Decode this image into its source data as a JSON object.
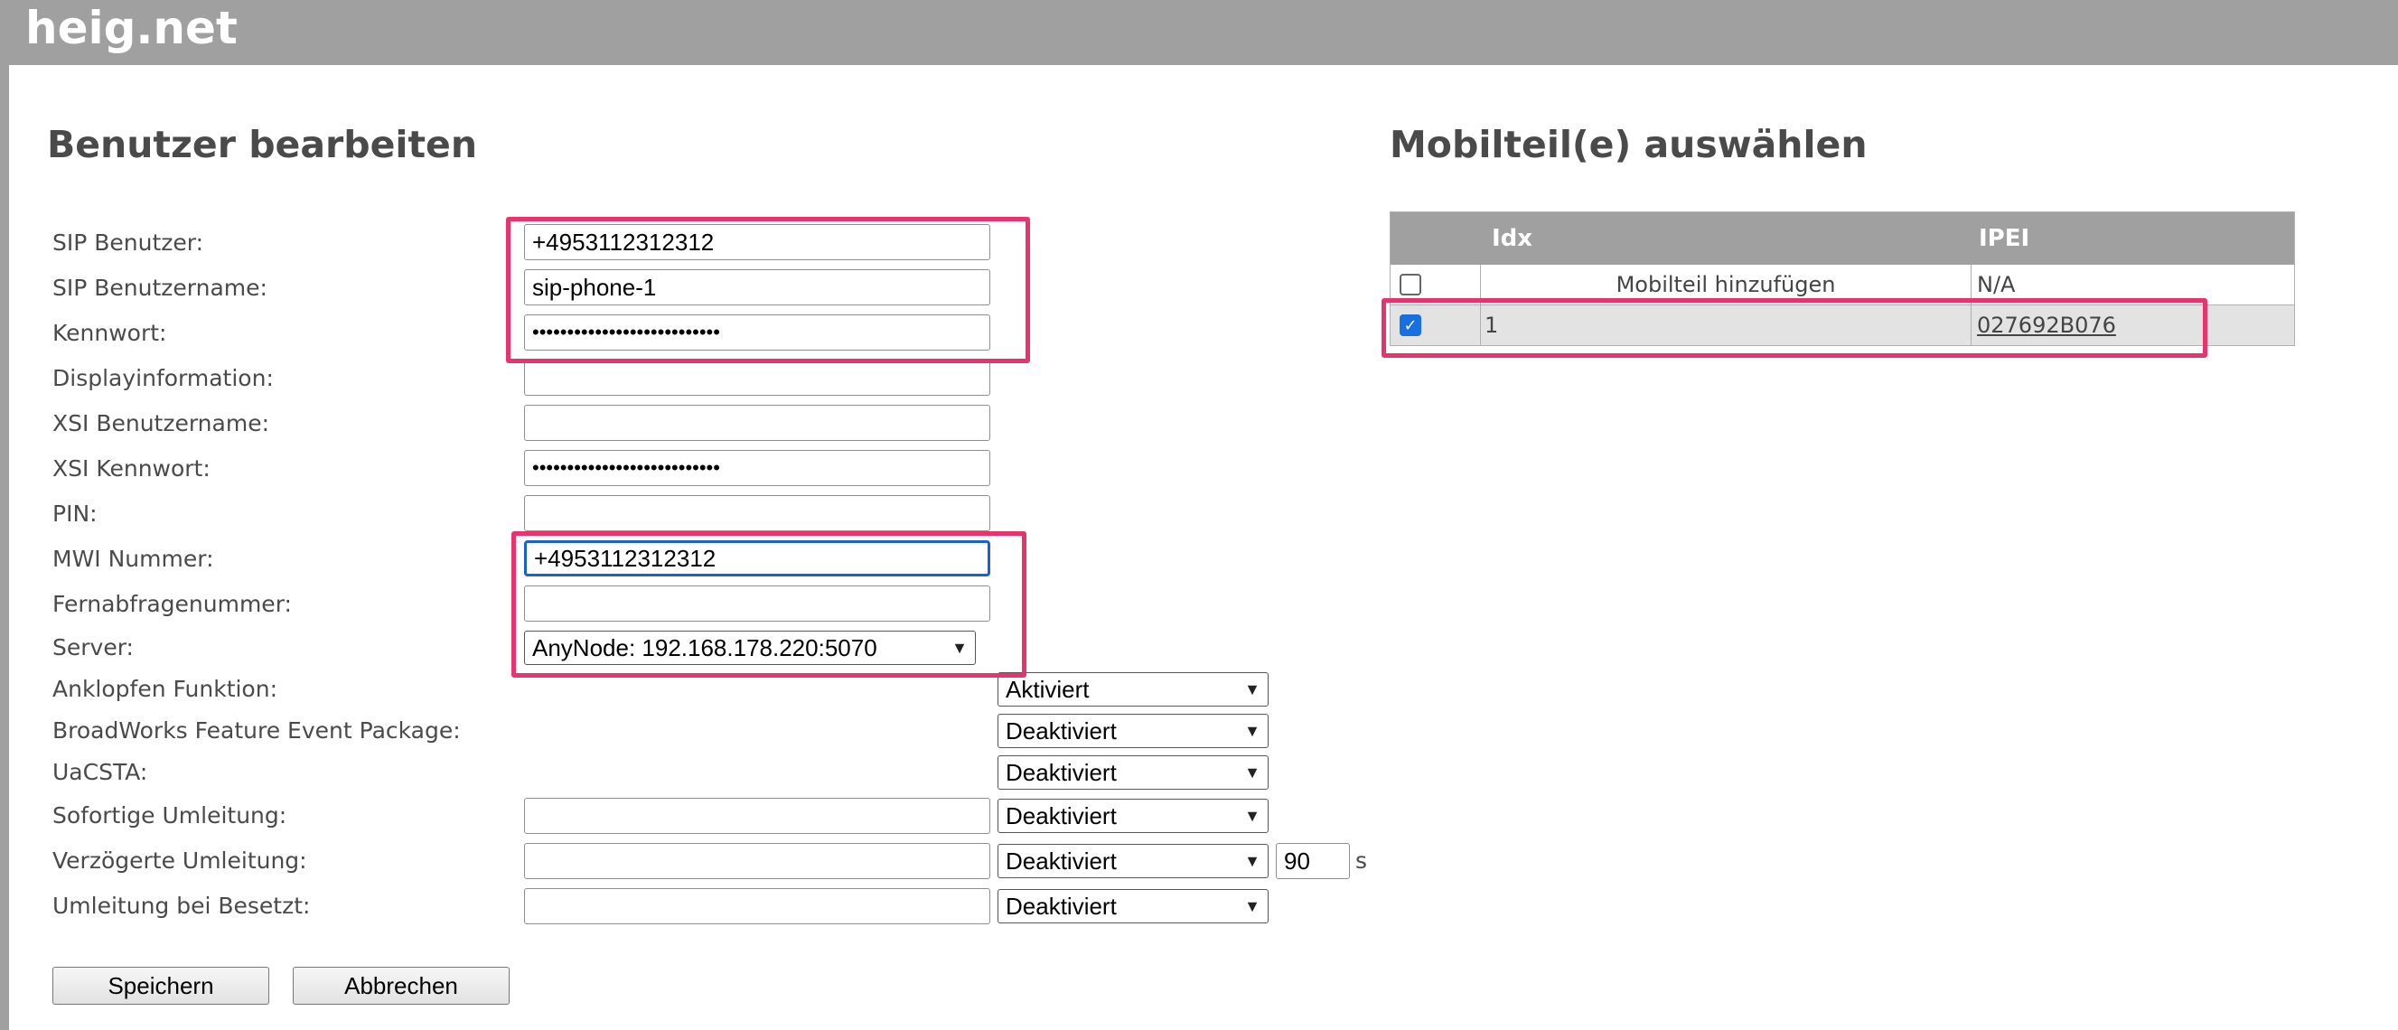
{
  "header": {
    "logo": "heig.net"
  },
  "left": {
    "title": "Benutzer bearbeiten",
    "fields": {
      "sip_user": {
        "label": "SIP Benutzer:",
        "value": "+4953112312312"
      },
      "sip_username": {
        "label": "SIP Benutzername:",
        "value": "sip-phone-1"
      },
      "password": {
        "label": "Kennwort:",
        "value": "•••••••••••••••••••••••••••"
      },
      "display_info": {
        "label": "Displayinformation:",
        "value": ""
      },
      "xsi_username": {
        "label": "XSI Benutzername:",
        "value": ""
      },
      "xsi_password": {
        "label": "XSI Kennwort:",
        "value": "•••••••••••••••••••••••••••"
      },
      "pin": {
        "label": "PIN:",
        "value": ""
      },
      "mwi_number": {
        "label": "MWI Nummer:",
        "value": "+4953112312312"
      },
      "remote_number": {
        "label": "Fernabfragenummer:",
        "value": ""
      },
      "server": {
        "label": "Server:",
        "value": "AnyNode: 192.168.178.220:5070"
      },
      "call_waiting": {
        "label": "Anklopfen Funktion:",
        "value": "Aktiviert"
      },
      "broadworks": {
        "label": "BroadWorks Feature Event Package:",
        "value": "Deaktiviert"
      },
      "uacsta": {
        "label": "UaCSTA:",
        "value": "Deaktiviert"
      },
      "immediate_fwd": {
        "label": "Sofortige Umleitung:",
        "value": "",
        "mode": "Deaktiviert"
      },
      "delayed_fwd": {
        "label": "Verzögerte Umleitung:",
        "value": "",
        "mode": "Deaktiviert",
        "delay": "90",
        "unit": "s"
      },
      "busy_fwd": {
        "label": "Umleitung bei Besetzt:",
        "value": "",
        "mode": "Deaktiviert"
      }
    },
    "buttons": {
      "save": "Speichern",
      "cancel": "Abbrechen"
    }
  },
  "right": {
    "title": "Mobilteil(e) auswählen",
    "columns": [
      "",
      "Idx",
      "IPEI"
    ],
    "rows": [
      {
        "checked": false,
        "idx": "Mobilteil hinzufügen",
        "ipei": "N/A"
      },
      {
        "checked": true,
        "idx": "1",
        "ipei": "027692B076"
      }
    ]
  },
  "colors": {
    "header_bg": "#a0a0a0",
    "highlight": "#e8336d",
    "focus": "#1a5fd6"
  }
}
